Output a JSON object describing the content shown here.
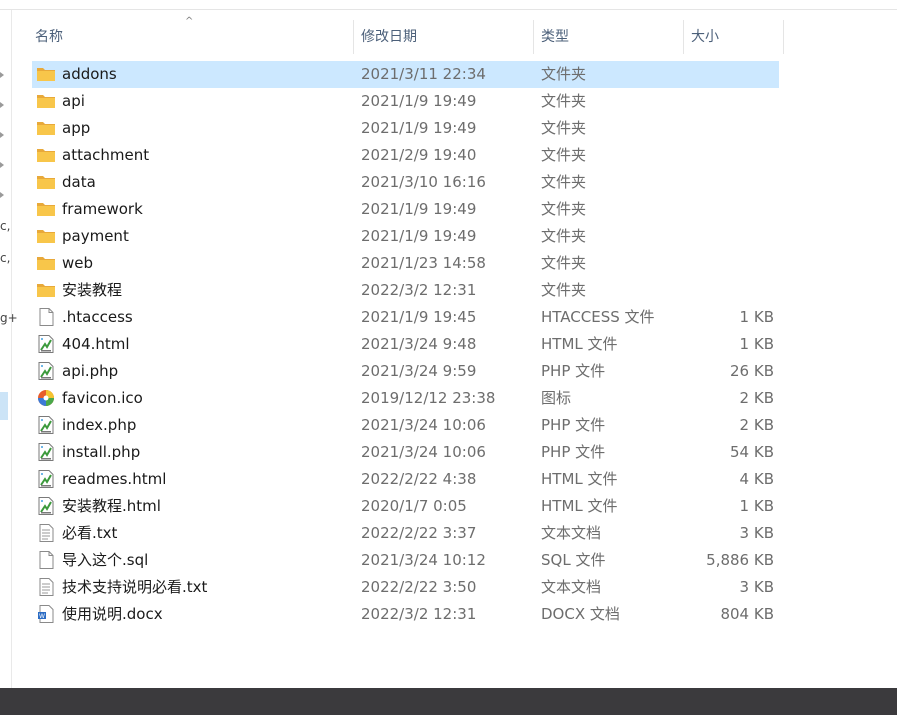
{
  "columns": {
    "name": "名称",
    "date": "修改日期",
    "type": "类型",
    "size": "大小"
  },
  "left_pane_chars": [
    "c,",
    "c,",
    "g+"
  ],
  "files": [
    {
      "name": "addons",
      "date": "2021/3/11 22:34",
      "type": "文件夹",
      "size": "",
      "icon": "folder-icon",
      "selected": true
    },
    {
      "name": "api",
      "date": "2021/1/9 19:49",
      "type": "文件夹",
      "size": "",
      "icon": "folder-icon"
    },
    {
      "name": "app",
      "date": "2021/1/9 19:49",
      "type": "文件夹",
      "size": "",
      "icon": "folder-icon"
    },
    {
      "name": "attachment",
      "date": "2021/2/9 19:40",
      "type": "文件夹",
      "size": "",
      "icon": "folder-icon"
    },
    {
      "name": "data",
      "date": "2021/3/10 16:16",
      "type": "文件夹",
      "size": "",
      "icon": "folder-icon"
    },
    {
      "name": "framework",
      "date": "2021/1/9 19:49",
      "type": "文件夹",
      "size": "",
      "icon": "folder-icon"
    },
    {
      "name": "payment",
      "date": "2021/1/9 19:49",
      "type": "文件夹",
      "size": "",
      "icon": "folder-icon"
    },
    {
      "name": "web",
      "date": "2021/1/23 14:58",
      "type": "文件夹",
      "size": "",
      "icon": "folder-icon"
    },
    {
      "name": "安装教程",
      "date": "2022/3/2 12:31",
      "type": "文件夹",
      "size": "",
      "icon": "folder-icon"
    },
    {
      "name": ".htaccess",
      "date": "2021/1/9 19:45",
      "type": "HTACCESS 文件",
      "size": "1 KB",
      "icon": "blank-file-icon"
    },
    {
      "name": "404.html",
      "date": "2021/3/24 9:48",
      "type": "HTML 文件",
      "size": "1 KB",
      "icon": "code-file-icon"
    },
    {
      "name": "api.php",
      "date": "2021/3/24 9:59",
      "type": "PHP 文件",
      "size": "26 KB",
      "icon": "code-file-icon"
    },
    {
      "name": "favicon.ico",
      "date": "2019/12/12 23:38",
      "type": "图标",
      "size": "2 KB",
      "icon": "favicon-icon"
    },
    {
      "name": "index.php",
      "date": "2021/3/24 10:06",
      "type": "PHP 文件",
      "size": "2 KB",
      "icon": "code-file-icon"
    },
    {
      "name": "install.php",
      "date": "2021/3/24 10:06",
      "type": "PHP 文件",
      "size": "54 KB",
      "icon": "code-file-icon"
    },
    {
      "name": "readmes.html",
      "date": "2022/2/22 4:38",
      "type": "HTML 文件",
      "size": "4 KB",
      "icon": "code-file-icon"
    },
    {
      "name": "安装教程.html",
      "date": "2020/1/7 0:05",
      "type": "HTML 文件",
      "size": "1 KB",
      "icon": "code-file-icon"
    },
    {
      "name": "必看.txt",
      "date": "2022/2/22 3:37",
      "type": "文本文档",
      "size": "3 KB",
      "icon": "text-file-icon"
    },
    {
      "name": "导入这个.sql",
      "date": "2021/3/24 10:12",
      "type": "SQL 文件",
      "size": "5,886 KB",
      "icon": "blank-file-icon"
    },
    {
      "name": "技术支持说明必看.txt",
      "date": "2022/2/22 3:50",
      "type": "文本文档",
      "size": "3 KB",
      "icon": "text-file-icon"
    },
    {
      "name": "使用说明.docx",
      "date": "2022/3/2 12:31",
      "type": "DOCX 文档",
      "size": "804 KB",
      "icon": "docx-file-icon"
    }
  ],
  "colors": {
    "selected_row": "#cce8ff",
    "header_text": "#4c607a",
    "secondary_text": "#6d6d6d",
    "taskbar": "#3b3a3d",
    "folder": "#f8c64a"
  }
}
